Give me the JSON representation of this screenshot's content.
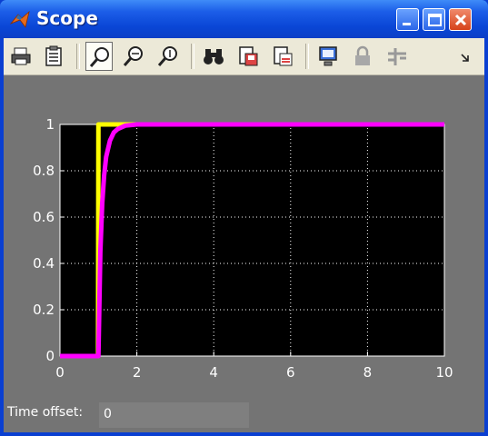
{
  "window": {
    "title": "Scope"
  },
  "toolbar": {
    "buttons": [
      {
        "name": "print-icon"
      },
      {
        "name": "parameters-icon"
      },
      {
        "name": "zoom-icon"
      },
      {
        "name": "zoom-x-icon"
      },
      {
        "name": "zoom-y-icon"
      },
      {
        "name": "autoscale-binoculars-icon"
      },
      {
        "name": "save-axes-settings-icon"
      },
      {
        "name": "restore-axes-settings-icon"
      },
      {
        "name": "floating-scope-icon"
      },
      {
        "name": "lock-axes-icon"
      },
      {
        "name": "signal-selection-icon"
      }
    ]
  },
  "status": {
    "time_offset_label": "Time offset:",
    "time_offset_value": "0"
  },
  "colors": {
    "axes_bg": "#000000",
    "figure_bg": "#747474",
    "series1": "#ffff00",
    "series2": "#ff00ff",
    "grid": "#ffffff"
  },
  "chart_data": {
    "type": "line",
    "xlim": [
      0,
      10
    ],
    "ylim": [
      0,
      1
    ],
    "xticks": [
      "0",
      "2",
      "4",
      "6",
      "8",
      "10"
    ],
    "yticks": [
      "0",
      "0.2",
      "0.4",
      "0.6",
      "0.8",
      "1"
    ],
    "grid": true,
    "series": [
      {
        "color": "#ffff00",
        "x": [
          0,
          0.99,
          1.0,
          1.3,
          10
        ],
        "y": [
          0,
          0,
          1,
          1,
          1
        ]
      },
      {
        "color": "#ff00ff",
        "x": [
          0,
          1.0,
          1.05,
          1.1,
          1.15,
          1.2,
          1.3,
          1.4,
          1.5,
          1.7,
          2.0,
          10
        ],
        "y": [
          0,
          0,
          0.45,
          0.66,
          0.78,
          0.86,
          0.93,
          0.965,
          0.98,
          0.995,
          1,
          1
        ]
      }
    ]
  }
}
